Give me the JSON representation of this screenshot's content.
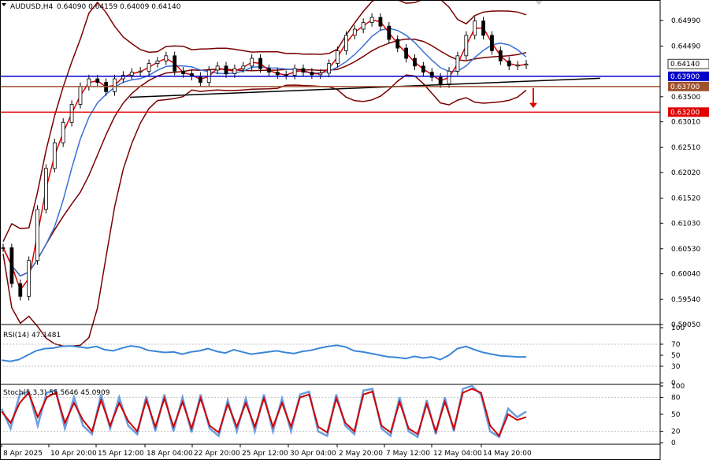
{
  "header": {
    "symbol": "AUDUSD,H4",
    "ohlc": "0.64090 0.64159 0.64009 0.64140"
  },
  "chart_data": [
    {
      "type": "line",
      "title": "AUDUSD,H4",
      "price_ticks": [
        "0.64990",
        "0.64490",
        "0.63500",
        "0.63010",
        "0.62510",
        "0.62020",
        "0.61520",
        "0.61030",
        "0.60530",
        "0.60040",
        "0.59540",
        "0.59050"
      ],
      "ylim": [
        0.5905,
        0.6539
      ],
      "time_labels": [
        "8 Apr 2025",
        "10 Apr 20:00",
        "15 Apr 12:00",
        "18 Apr 04:00",
        "22 Apr 20:00",
        "25 Apr 12:00",
        "30 Apr 04:00",
        "2 May 20:00",
        "7 May 12:00",
        "12 May 04:00",
        "14 May 20:00"
      ],
      "series": [
        {
          "name": "Close",
          "values": [
            0.6055,
            0.5985,
            0.596,
            0.603,
            0.613,
            0.621,
            0.626,
            0.63,
            0.6335,
            0.637,
            0.6385,
            0.6378,
            0.636,
            0.6385,
            0.6392,
            0.6398,
            0.64,
            0.6415,
            0.642,
            0.643,
            0.64,
            0.6395,
            0.639,
            0.6378,
            0.6402,
            0.641,
            0.6395,
            0.6405,
            0.641,
            0.6425,
            0.6405,
            0.6398,
            0.6393,
            0.6392,
            0.6405,
            0.6398,
            0.6393,
            0.6396,
            0.6415,
            0.644,
            0.647,
            0.6482,
            0.6495,
            0.6505,
            0.6488,
            0.6462,
            0.6445,
            0.6425,
            0.641,
            0.6398,
            0.6388,
            0.6375,
            0.64,
            0.643,
            0.647,
            0.6498,
            0.647,
            0.644,
            0.642,
            0.641,
            0.6412,
            0.6414
          ]
        }
      ],
      "levels": [
        {
          "label": "0.63900",
          "value": 0.639,
          "color": "#0000c8"
        },
        {
          "label": "0.63700",
          "value": 0.637,
          "color": "#a0522d"
        },
        {
          "label": "0.63200",
          "value": 0.632,
          "color": "#e00000"
        }
      ],
      "current_price": "0.64140",
      "current_price_value": 0.6414,
      "price_shown_near_current": "0.64140",
      "colors": {
        "bollinger": "#7a0000",
        "ma_fast": "#e00000",
        "ma_slow": "#3a6fd8",
        "trendline": "#000000",
        "arrow": "#e00000"
      }
    },
    {
      "type": "line",
      "title": "RSI(14) 47.1481",
      "ylim": [
        0,
        100
      ],
      "ticks": [
        "100",
        "70",
        "50",
        "30",
        "0"
      ],
      "series": [
        {
          "name": "RSI(14)",
          "values": [
            41,
            39,
            42,
            50,
            58,
            62,
            63,
            66,
            67,
            65,
            63,
            66,
            60,
            58,
            63,
            67,
            65,
            59,
            57,
            55,
            56,
            52,
            56,
            58,
            62,
            57,
            54,
            60,
            56,
            52,
            54,
            56,
            58,
            55,
            53,
            57,
            59,
            63,
            66,
            68,
            65,
            58,
            56,
            53,
            50,
            47,
            46,
            44,
            48,
            45,
            47,
            42,
            50,
            62,
            66,
            60,
            55,
            52,
            49,
            48,
            47,
            47
          ]
        }
      ],
      "color": "#3a86d8"
    },
    {
      "type": "line",
      "title": "Stoch(5,3,3) 55.5646 45.0909",
      "ylim": [
        0,
        100
      ],
      "ticks": [
        "100",
        "80",
        "50",
        "20",
        "0"
      ],
      "series": [
        {
          "name": "%K",
          "values": [
            60,
            25,
            85,
            90,
            30,
            88,
            92,
            25,
            80,
            30,
            15,
            85,
            25,
            80,
            30,
            15,
            82,
            20,
            85,
            20,
            80,
            18,
            85,
            25,
            12,
            75,
            20,
            78,
            20,
            85,
            20,
            78,
            20,
            85,
            90,
            20,
            12,
            85,
            30,
            15,
            92,
            95,
            25,
            12,
            80,
            20,
            10,
            75,
            15,
            80,
            20,
            95,
            100,
            85,
            20,
            10,
            60,
            45,
            55
          ]
        },
        {
          "name": "%D",
          "values": [
            55,
            35,
            70,
            88,
            45,
            80,
            88,
            35,
            70,
            40,
            20,
            75,
            30,
            70,
            38,
            20,
            75,
            28,
            78,
            28,
            72,
            25,
            78,
            30,
            18,
            68,
            28,
            70,
            28,
            78,
            28,
            70,
            28,
            80,
            85,
            28,
            18,
            78,
            35,
            20,
            85,
            90,
            30,
            18,
            72,
            25,
            15,
            68,
            20,
            72,
            25,
            88,
            95,
            88,
            30,
            12,
            50,
            40,
            45
          ]
        }
      ],
      "colors": {
        "k": "#6a9ee0",
        "d": "#d00000"
      }
    }
  ]
}
